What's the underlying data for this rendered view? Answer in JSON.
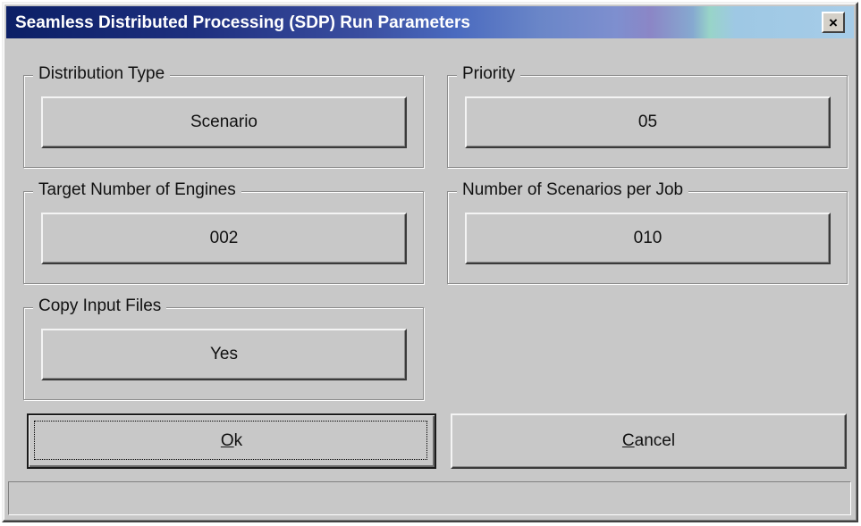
{
  "window": {
    "title": "Seamless Distributed Processing (SDP) Run Parameters",
    "close_label": "×"
  },
  "groups": {
    "distribution_type": {
      "label": "Distribution Type",
      "value": "Scenario"
    },
    "priority": {
      "label": "Priority",
      "value": "05"
    },
    "target_engines": {
      "label": "Target Number of Engines",
      "value": "002"
    },
    "scenarios_per_job": {
      "label": "Number of Scenarios per Job",
      "value": "010"
    },
    "copy_input_files": {
      "label": "Copy Input Files",
      "value": "Yes"
    }
  },
  "buttons": {
    "ok": {
      "mnemonic": "O",
      "rest": "k"
    },
    "cancel": {
      "mnemonic": "C",
      "rest": "ancel"
    }
  },
  "status_text": ""
}
